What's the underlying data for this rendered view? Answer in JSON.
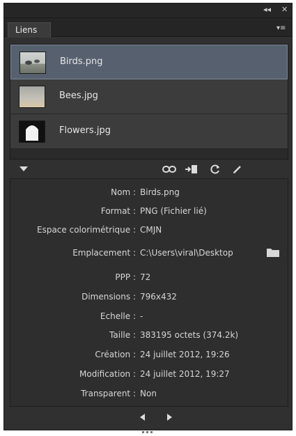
{
  "window": {
    "collapse_glyph": "◂◂",
    "close_glyph": "✕",
    "menu_glyph": "▾≡"
  },
  "tab": {
    "label": "Liens"
  },
  "links": [
    {
      "name": "Birds.png",
      "selected": true
    },
    {
      "name": "Bees.jpg",
      "selected": false
    },
    {
      "name": "Flowers.jpg",
      "selected": false
    }
  ],
  "toolbar": {
    "expand_icon": "triangle-down",
    "relink_icon": "chain-link",
    "goto_icon": "go-to-link",
    "update_icon": "refresh",
    "edit_icon": "pencil"
  },
  "info": {
    "nom_label": "Nom :",
    "nom_value": "Birds.png",
    "format_label": "Format :",
    "format_value": "PNG (Fichier lié)",
    "espace_label": "Espace colorimétrique :",
    "espace_value": "CMJN",
    "emplacement_label": "Emplacement :",
    "emplacement_value": "C:\\Users\\viral\\Desktop",
    "ppp_label": "PPP :",
    "ppp_value": "72",
    "dimensions_label": "Dimensions :",
    "dimensions_value": "796x432",
    "echelle_label": "Echelle :",
    "echelle_value": "-",
    "taille_label": "Taille :",
    "taille_value": "383195 octets (374.2k)",
    "creation_label": "Création :",
    "creation_value": "24 juillet 2012, 19:26",
    "modification_label": "Modification :",
    "modification_value": "24 juillet 2012, 19:27",
    "transparent_label": "Transparent :",
    "transparent_value": "Non"
  },
  "colors": {
    "panel": "#303030",
    "selected_row": "#56606f",
    "text": "#d6d6d6"
  }
}
